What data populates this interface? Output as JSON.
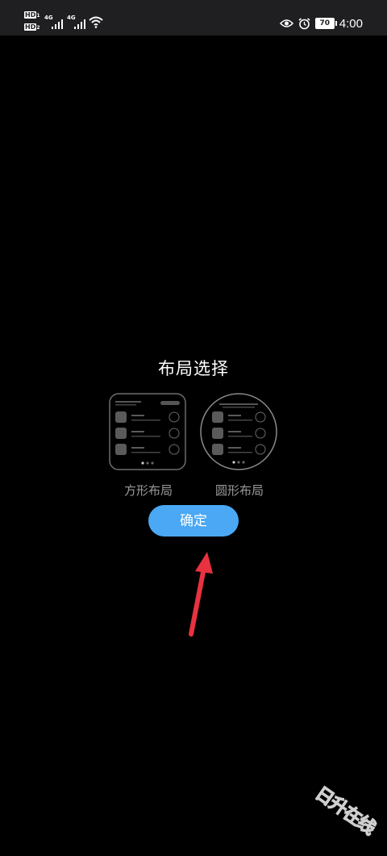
{
  "status_bar": {
    "sim1": "HD",
    "sim2": "HD",
    "network1": "4G",
    "network2": "4G",
    "battery": "70",
    "time": "4:00",
    "icons": [
      "eye-icon",
      "alarm-icon",
      "wifi-icon",
      "signal-icon"
    ]
  },
  "dialog": {
    "title": "布局选择",
    "options": [
      {
        "label": "方形布局",
        "shape": "square"
      },
      {
        "label": "圆形布局",
        "shape": "round"
      }
    ],
    "confirm_label": "确定"
  },
  "annotation": {
    "arrow_color": "#e8323f"
  },
  "watermark": {
    "text": "日升在线"
  },
  "colors": {
    "accent": "#4aa8f4",
    "background": "#000000",
    "statusbar": "#1f1f21"
  }
}
